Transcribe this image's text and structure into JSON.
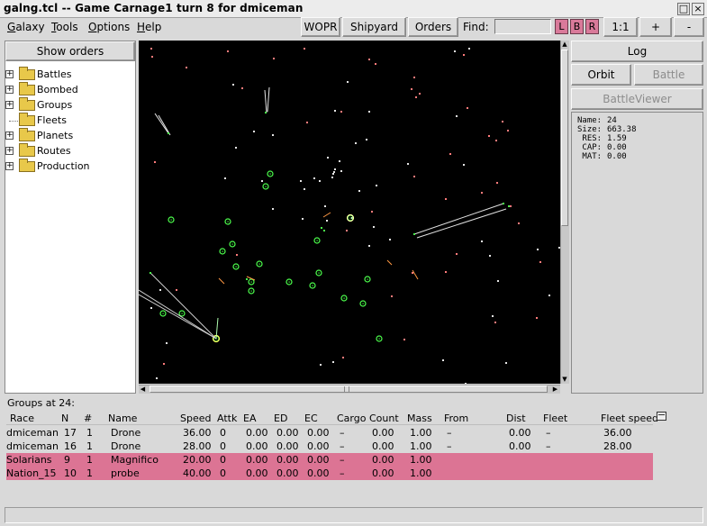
{
  "window": {
    "title": "galng.tcl -- Game Carnage1 turn 8 for dmiceman",
    "controls": [
      "□",
      "×"
    ]
  },
  "menubar": {
    "items": [
      {
        "label": "Galaxy",
        "ul": "G"
      },
      {
        "label": "Tools",
        "ul": "T"
      },
      {
        "label": "Options",
        "ul": "O"
      },
      {
        "label": "Help",
        "ul": "H"
      }
    ]
  },
  "toolbar": {
    "wopr": "WOPR",
    "shipyard": "Shipyard",
    "orders": "Orders",
    "find_label": "Find:",
    "find_value": "",
    "l": "L",
    "b": "B",
    "r": "R",
    "zoom": "1:1",
    "plus": "+",
    "minus": "-"
  },
  "left": {
    "show_orders": "Show orders",
    "tree": [
      {
        "label": "Battles",
        "expandable": true
      },
      {
        "label": "Bombed",
        "expandable": true
      },
      {
        "label": "Groups",
        "expandable": true
      },
      {
        "label": "Fleets",
        "expandable": false
      },
      {
        "label": "Planets",
        "expandable": true
      },
      {
        "label": "Routes",
        "expandable": true
      },
      {
        "label": "Production",
        "expandable": true
      }
    ]
  },
  "right": {
    "log": "Log",
    "orbit": "Orbit",
    "battle": "Battle",
    "battleviewer": "BattleViewer",
    "info": [
      {
        "k": "Name:",
        "v": "24"
      },
      {
        "k": "Size:",
        "v": "663.38"
      },
      {
        "k": " RES:",
        "v": "1.59"
      },
      {
        "k": " CAP:",
        "v": "0.00"
      },
      {
        "k": " MAT:",
        "v": "0.00"
      }
    ]
  },
  "groups": {
    "title": "Groups at 24:",
    "headers": [
      "Race",
      "N",
      "#",
      "Name",
      "Speed",
      "Attk",
      "EA",
      "ED",
      "EC",
      "Cargo",
      "Count",
      "Mass",
      "From",
      "Dist",
      "Fleet",
      "Fleet speed"
    ],
    "rows": [
      {
        "race": "dmiceman",
        "n": "17",
        "num": "1",
        "name": "Drone",
        "speed": "36.00",
        "attk": "0",
        "ea": "0.00",
        "ed": "0.00",
        "ec": "0.00",
        "cargo": "–",
        "count": "0.00",
        "mass": "1.00",
        "from": "–",
        "dist": "0.00",
        "fleet": "–",
        "fleet_speed": "36.00",
        "highlight": false
      },
      {
        "race": "dmiceman",
        "n": "16",
        "num": "1",
        "name": "Drone",
        "speed": "28.00",
        "attk": "0",
        "ea": "0.00",
        "ed": "0.00",
        "ec": "0.00",
        "cargo": "–",
        "count": "0.00",
        "mass": "1.00",
        "from": "–",
        "dist": "0.00",
        "fleet": "–",
        "fleet_speed": "28.00",
        "highlight": false
      },
      {
        "race": "Solarians",
        "n": "9",
        "num": "1",
        "name": "Magnifico",
        "speed": "20.00",
        "attk": "0",
        "ea": "0.00",
        "ed": "0.00",
        "ec": "0.00",
        "cargo": "–",
        "count": "0.00",
        "mass": "1.00",
        "from": "",
        "dist": "",
        "fleet": "",
        "fleet_speed": "",
        "highlight": true
      },
      {
        "race": "Nation_15",
        "n": "10",
        "num": "1",
        "name": "probe",
        "speed": "40.00",
        "attk": "0",
        "ea": "0.00",
        "ed": "0.00",
        "ec": "0.00",
        "cargo": "–",
        "count": "0.00",
        "mass": "1.00",
        "from": "",
        "dist": "",
        "fleet": "",
        "fleet_speed": "",
        "highlight": true
      }
    ]
  },
  "colors": {
    "highlight_row": "#dc7494",
    "planet_green": "#4cff4c",
    "star_pink": "#ff7b7b",
    "star_white": "#e6e6e6"
  }
}
